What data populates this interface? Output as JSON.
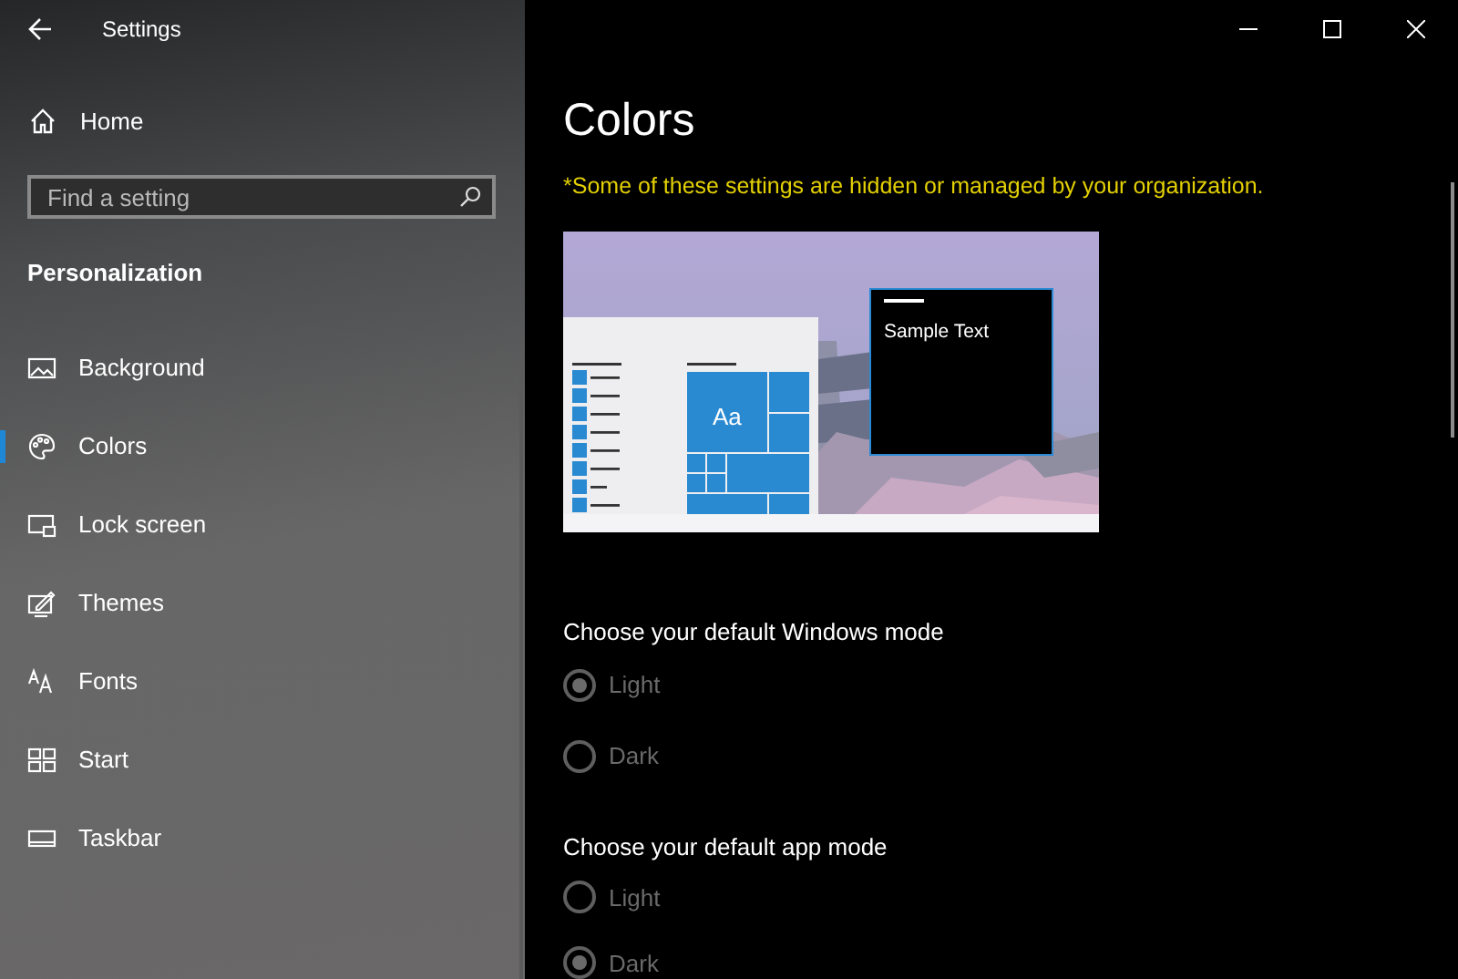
{
  "window": {
    "title": "Settings"
  },
  "sidebar": {
    "home": "Home",
    "search": {
      "placeholder": "Find a setting"
    },
    "section": "Personalization",
    "items": [
      {
        "label": "Background",
        "selected": false
      },
      {
        "label": "Colors",
        "selected": true
      },
      {
        "label": "Lock screen",
        "selected": false
      },
      {
        "label": "Themes",
        "selected": false
      },
      {
        "label": "Fonts",
        "selected": false
      },
      {
        "label": "Start",
        "selected": false
      },
      {
        "label": "Taskbar",
        "selected": false
      }
    ]
  },
  "main": {
    "title": "Colors",
    "notice": "*Some of these settings are hidden or managed by your organization.",
    "preview": {
      "tile_label": "Aa",
      "sample_text": "Sample Text"
    },
    "groups": [
      {
        "heading": "Choose your default Windows mode",
        "options": [
          {
            "label": "Light",
            "selected": true,
            "disabled": true
          },
          {
            "label": "Dark",
            "selected": false,
            "disabled": true
          }
        ]
      },
      {
        "heading": "Choose your default app mode",
        "options": [
          {
            "label": "Light",
            "selected": false,
            "disabled": true
          },
          {
            "label": "Dark",
            "selected": true,
            "disabled": true
          }
        ]
      }
    ]
  }
}
